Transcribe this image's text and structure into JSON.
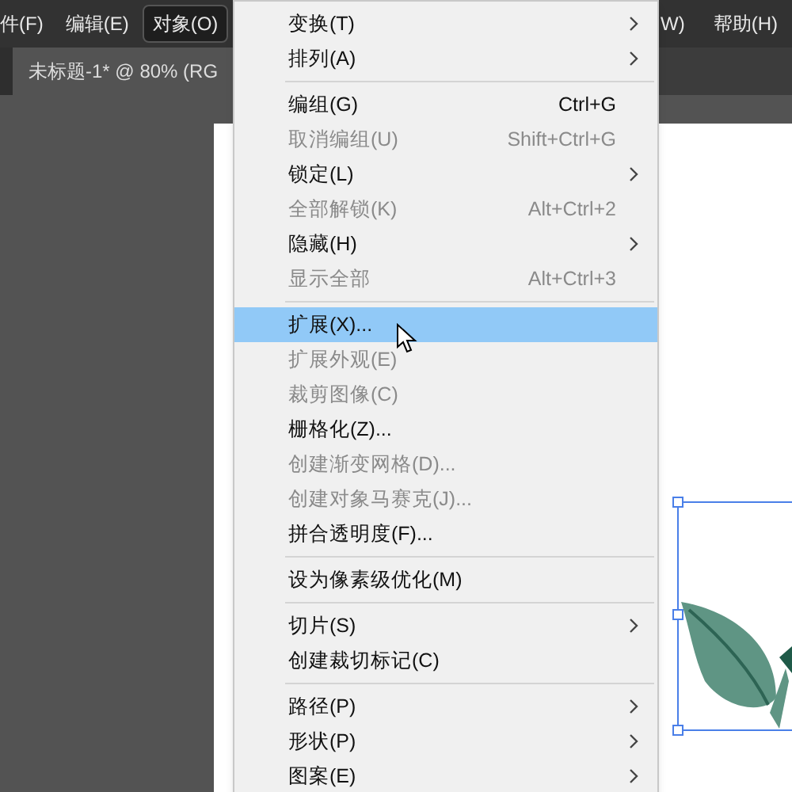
{
  "menubar": [
    {
      "label": "件(F)",
      "selected": false
    },
    {
      "label": "编辑(E)",
      "selected": false
    },
    {
      "label": "对象(O)",
      "selected": true
    }
  ],
  "menubar_right": [
    {
      "label": "W)",
      "selected": false
    },
    {
      "label": "帮助(H)",
      "selected": false
    }
  ],
  "document_tab": {
    "title": "未标题-1* @ 80% (RG"
  },
  "menu": {
    "groups": [
      [
        {
          "label": "变换(T)",
          "submenu": true,
          "disabled": false,
          "selected": false
        },
        {
          "label": "排列(A)",
          "submenu": true,
          "disabled": false,
          "selected": false
        }
      ],
      [
        {
          "label": "编组(G)",
          "shortcut": "Ctrl+G",
          "submenu": false,
          "disabled": false,
          "selected": false
        },
        {
          "label": "取消编组(U)",
          "shortcut": "Shift+Ctrl+G",
          "submenu": false,
          "disabled": true,
          "selected": false
        },
        {
          "label": "锁定(L)",
          "submenu": true,
          "disabled": false,
          "selected": false
        },
        {
          "label": "全部解锁(K)",
          "shortcut": "Alt+Ctrl+2",
          "submenu": false,
          "disabled": true,
          "selected": false
        },
        {
          "label": "隐藏(H)",
          "submenu": true,
          "disabled": false,
          "selected": false
        },
        {
          "label": "显示全部",
          "shortcut": "Alt+Ctrl+3",
          "submenu": false,
          "disabled": true,
          "selected": false
        }
      ],
      [
        {
          "label": "扩展(X)...",
          "submenu": false,
          "disabled": false,
          "selected": true
        },
        {
          "label": "扩展外观(E)",
          "submenu": false,
          "disabled": true,
          "selected": false
        },
        {
          "label": "裁剪图像(C)",
          "submenu": false,
          "disabled": true,
          "selected": false
        },
        {
          "label": "栅格化(Z)...",
          "submenu": false,
          "disabled": false,
          "selected": false
        },
        {
          "label": "创建渐变网格(D)...",
          "submenu": false,
          "disabled": true,
          "selected": false
        },
        {
          "label": "创建对象马赛克(J)...",
          "submenu": false,
          "disabled": true,
          "selected": false
        },
        {
          "label": "拼合透明度(F)...",
          "submenu": false,
          "disabled": false,
          "selected": false
        }
      ],
      [
        {
          "label": "设为像素级优化(M)",
          "submenu": false,
          "disabled": false,
          "selected": false
        }
      ],
      [
        {
          "label": "切片(S)",
          "submenu": true,
          "disabled": false,
          "selected": false
        },
        {
          "label": "创建裁切标记(C)",
          "submenu": false,
          "disabled": false,
          "selected": false
        }
      ],
      [
        {
          "label": "路径(P)",
          "submenu": true,
          "disabled": false,
          "selected": false
        },
        {
          "label": "形状(P)",
          "submenu": true,
          "disabled": false,
          "selected": false
        },
        {
          "label": "图案(E)",
          "submenu": true,
          "disabled": false,
          "selected": false
        }
      ]
    ]
  }
}
